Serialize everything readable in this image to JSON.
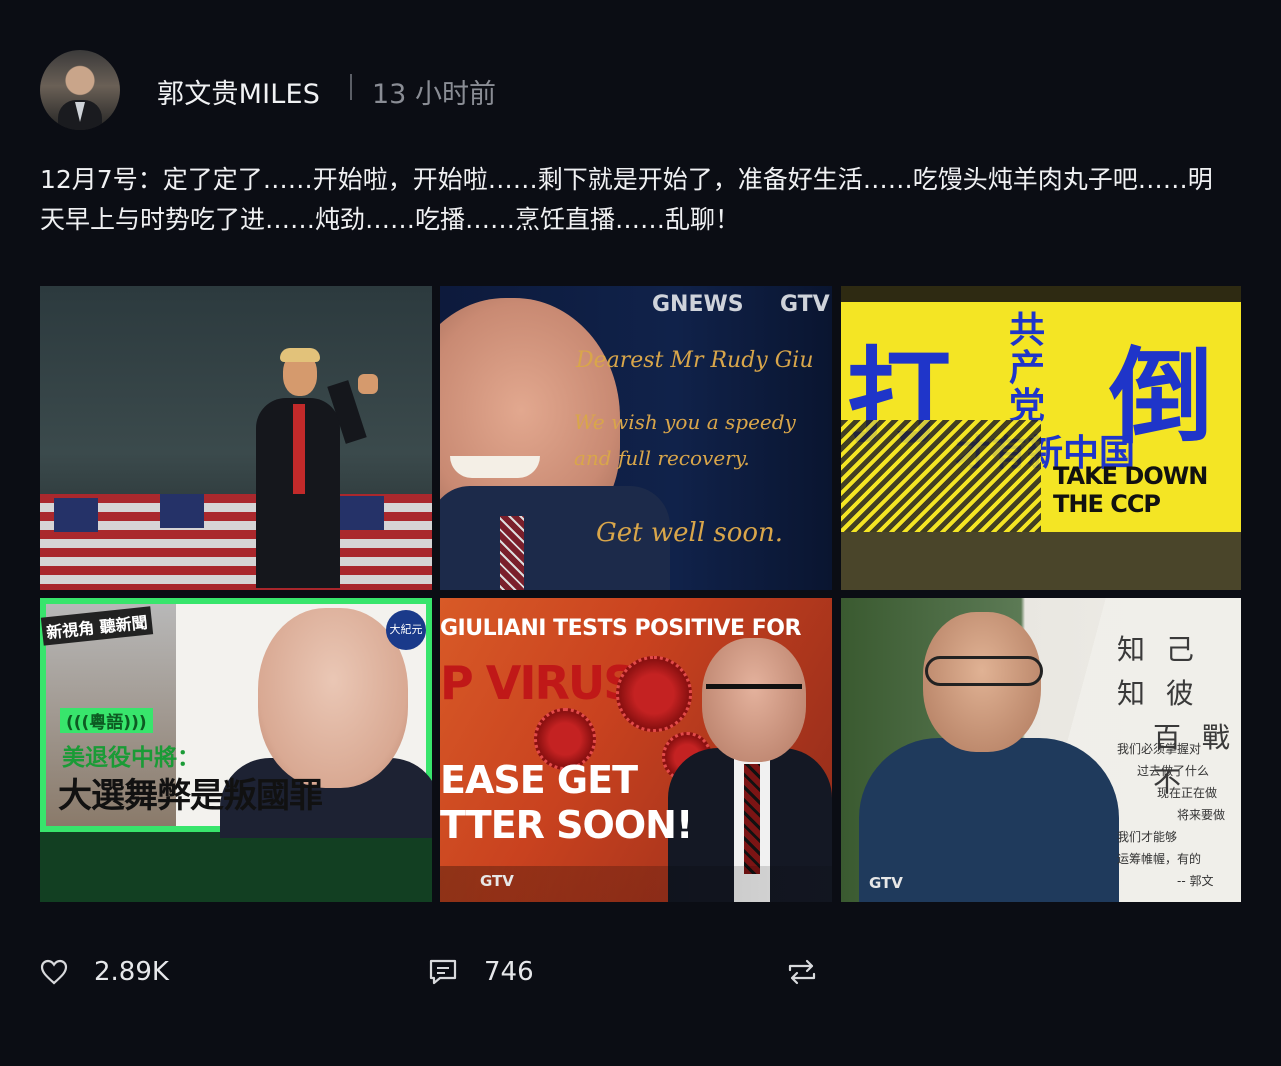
{
  "post": {
    "author": "郭文贵MILES",
    "time": "13 小时前",
    "text": "12月7号：定了定了……开始啦，开始啦……剩下就是开始了，准备好生活……吃馒头炖羊肉丸子吧……明天早上与时势吃了进……炖劲……吃播……烹饪直播……乱聊！"
  },
  "images": [
    {
      "name": "rally"
    },
    {
      "name": "get-well-card",
      "logo1": "GNEWS",
      "logo2": "GTV",
      "line1": "Dearest Mr Rudy Giu",
      "line2": "We wish you a speedy",
      "line3": "and full recovery.",
      "line4": "Get well soon."
    },
    {
      "name": "poster",
      "big1": "打",
      "big2": "共产党",
      "big3": "倒",
      "sub": "才有新中国",
      "en": "TAKE DOWN THE CCP"
    },
    {
      "name": "news-thumb",
      "tag": "新視角 聽新聞",
      "lang": "(((粵語)))",
      "line1": "美退役中將：",
      "line2": "大選舞弊是叛國罪",
      "badge": "大紀元"
    },
    {
      "name": "covid-thumb",
      "headline": "GIULIANI TESTS POSITIVE FOR",
      "virus": "P VIRUS",
      "please": "EASE GET",
      "better": "TTER SOON!",
      "logo": "GTV"
    },
    {
      "name": "portrait",
      "c1": "知 己 知 彼",
      "c2": "百 戰 不",
      "lines": [
        "我们必须掌握对",
        "过去做了什么",
        "现在正在做",
        "将来要做",
        "我们才能够",
        "运筹帷幄，有的",
        "-- 郭文"
      ],
      "logo": "GTV"
    }
  ],
  "actions": {
    "likes": "2.89K",
    "comments": "746",
    "icons": [
      "heart-icon",
      "comment-icon",
      "repost-icon"
    ]
  },
  "colors": {
    "background": "#0b0d14",
    "text": "#f0f1f3",
    "muted": "#8a8d95"
  }
}
